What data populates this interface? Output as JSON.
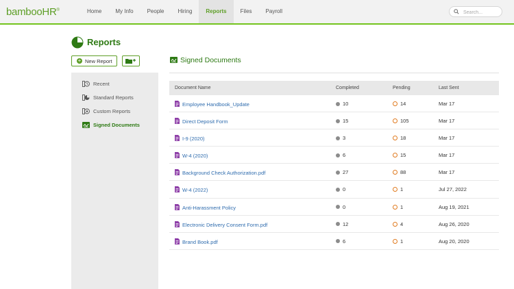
{
  "app": {
    "logo_text": "bamboo",
    "logo_suffix": "HR",
    "logo_mark": "®"
  },
  "nav": [
    "Home",
    "My Info",
    "People",
    "Hiring",
    "Reports",
    "Files",
    "Payroll"
  ],
  "nav_active": "Reports",
  "search": {
    "placeholder": "Search..."
  },
  "page": {
    "title": "Reports",
    "title_icon": "pie-chart-icon"
  },
  "buttons": {
    "new_report": "New Report",
    "new_folder_icon": "folder-plus-icon"
  },
  "sidebar": {
    "items": [
      {
        "label": "Recent",
        "icon": "clock-icon"
      },
      {
        "label": "Standard Reports",
        "icon": "standard-reports-icon"
      },
      {
        "label": "Custom Reports",
        "icon": "custom-reports-icon"
      },
      {
        "label": "Signed Documents",
        "icon": "signature-icon"
      }
    ],
    "active": "Signed Documents"
  },
  "section": {
    "title": "Signed Documents",
    "icon": "signature-icon"
  },
  "table": {
    "columns": [
      "Document Name",
      "Completed",
      "Pending",
      "Last Sent"
    ],
    "rows": [
      {
        "name": "Employee Handbook_Update",
        "completed": "10",
        "pending": "14",
        "last_sent": "Mar 17"
      },
      {
        "name": "Direct Deposit Form",
        "completed": "15",
        "pending": "105",
        "last_sent": "Mar 17"
      },
      {
        "name": "I-9 (2020)",
        "completed": "3",
        "pending": "18",
        "last_sent": "Mar 17"
      },
      {
        "name": "W-4 (2020)",
        "completed": "6",
        "pending": "15",
        "last_sent": "Mar 17"
      },
      {
        "name": "Background Check Authorization.pdf",
        "completed": "27",
        "pending": "88",
        "last_sent": "Mar 17"
      },
      {
        "name": "W-4 (2022)",
        "completed": "0",
        "pending": "1",
        "last_sent": "Jul 27, 2022"
      },
      {
        "name": "Anti-Harassment Policy",
        "completed": "0",
        "pending": "1",
        "last_sent": "Aug 19, 2021"
      },
      {
        "name": "Electronic Delivery Consent Form.pdf",
        "completed": "12",
        "pending": "4",
        "last_sent": "Aug 26, 2020"
      },
      {
        "name": "Brand Book.pdf",
        "completed": "6",
        "pending": "1",
        "last_sent": "Aug 20, 2020"
      }
    ]
  },
  "colors": {
    "brand_green": "#5d9e26",
    "dark_green": "#2e7a14",
    "link_blue": "#2f6cae",
    "pending_orange": "#e07a1f",
    "doc_purple": "#8e3fa8"
  }
}
